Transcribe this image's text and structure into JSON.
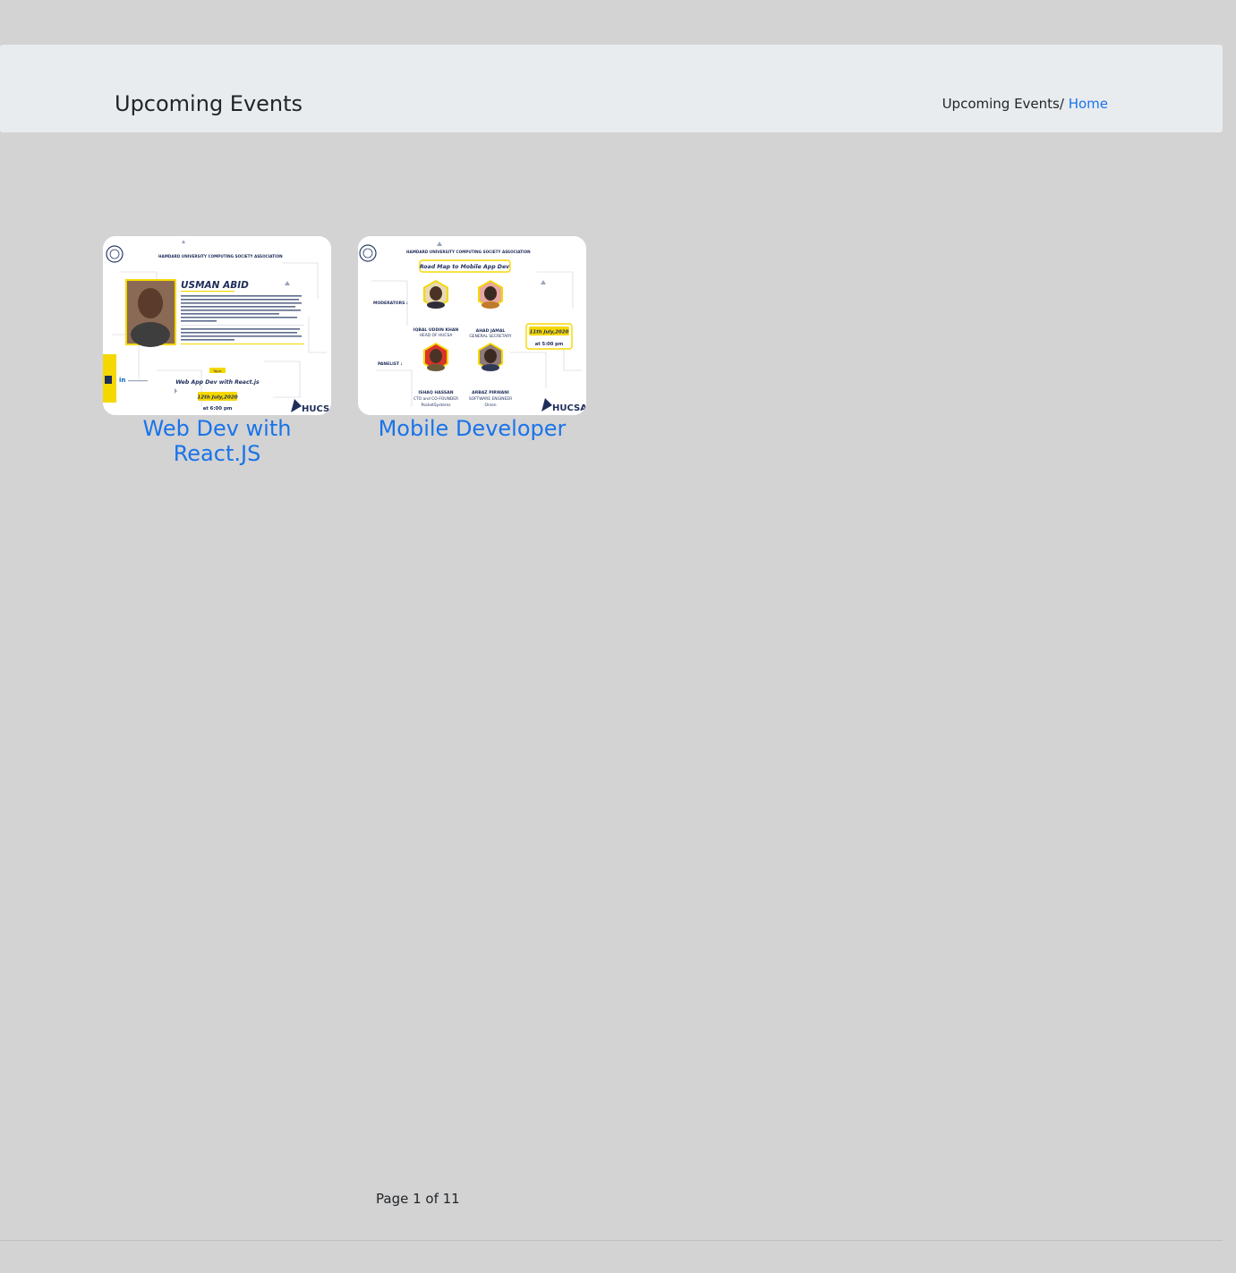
{
  "header": {
    "title": "Upcoming Events",
    "breadcrumb_current": "Upcoming Events/",
    "breadcrumb_home": "Home"
  },
  "events": [
    {
      "title": "Web Dev with React.JS",
      "poster": {
        "org": "HAMDARD UNIVERSITY COMPUTING SOCIETY ASSOCIATION",
        "speaker": "USMAN ABID",
        "topic_label": "Topic",
        "topic": "Web App Dev with React.js",
        "date": "12th July,2020",
        "time": "at 6:00 pm",
        "brand": "HUCSA"
      }
    },
    {
      "title": "Mobile Developer",
      "poster": {
        "org": "HAMDARD UNIVERSITY COMPUTING SOCIETY ASSOCIATION",
        "headline": "Road Map to Mobile App Dev",
        "moderators_label": "MODERATORS :",
        "panelist_label": "PANELIST :",
        "people": [
          {
            "name": "IQBAL UDDIN KHAN",
            "role": "HEAD OF HUCSA"
          },
          {
            "name": "AHAD JAMAL",
            "role": "GENERAL SECRETARY"
          },
          {
            "name": "ISHAQ HASSAN",
            "role": "CTO and CO-FOUNDER",
            "org": "PocketSystems"
          },
          {
            "name": "ARBAZ PIRWANI",
            "role": "SOFTWARE ENGINEER",
            "org": "Orsen"
          }
        ],
        "date": "11th July,2020",
        "time": "at 5:00 pm",
        "brand": "HUCSA"
      }
    }
  ],
  "pagination": {
    "text": "Page 1 of 11"
  },
  "colors": {
    "background": "#d3d3d3",
    "header_bg": "#e9ecef",
    "link": "#1a73e8",
    "poster_accent": "#f5d800",
    "poster_navy": "#1f2d5a"
  }
}
